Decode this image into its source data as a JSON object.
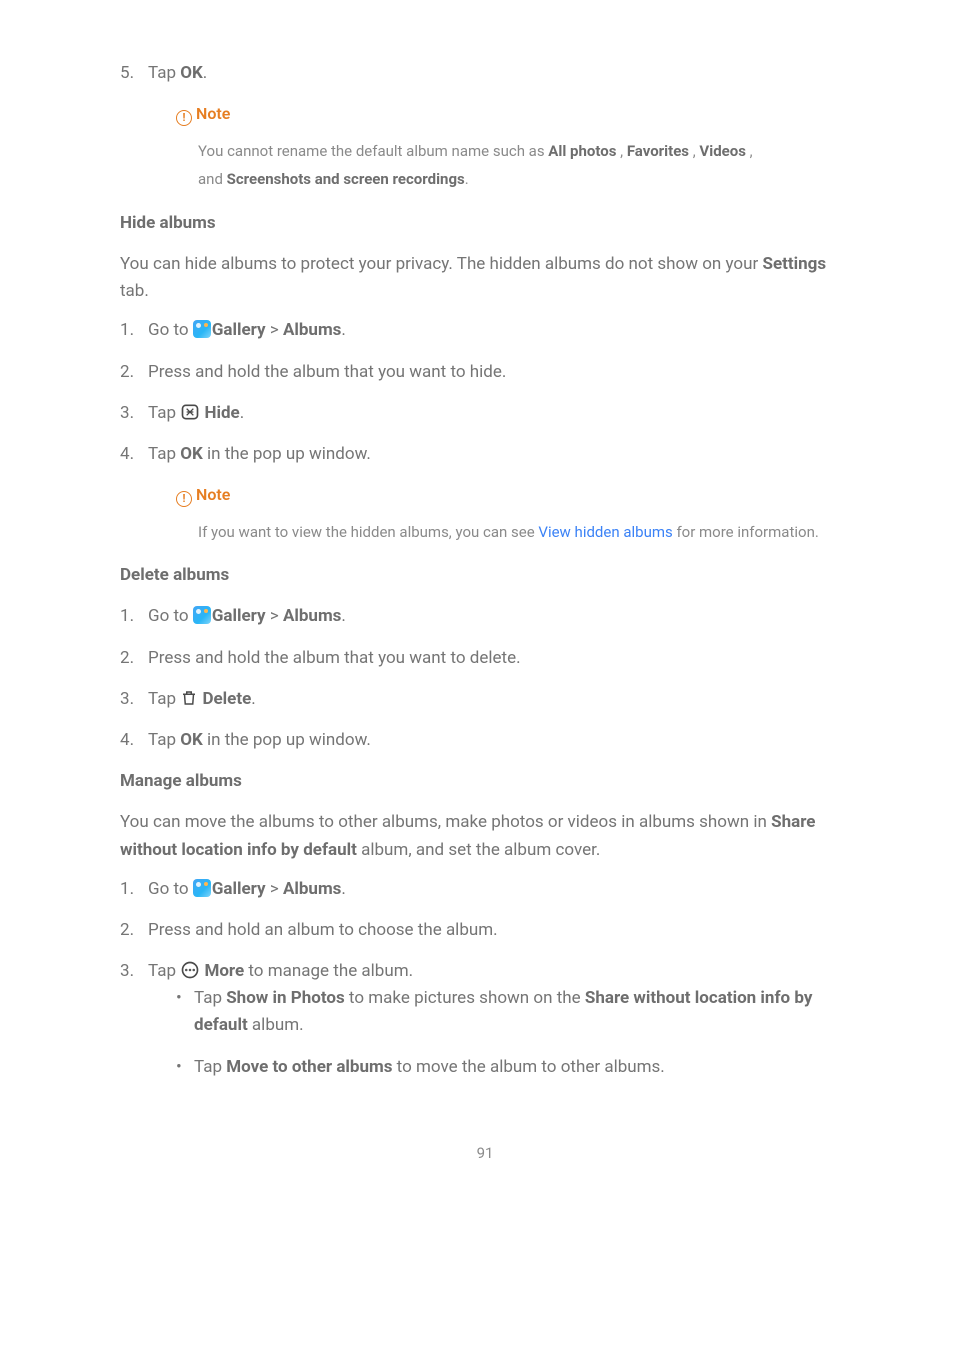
{
  "step5": {
    "prefix": "Tap ",
    "bold": "OK",
    "suffix": "."
  },
  "note1": {
    "label": "Note",
    "info_glyph": "!",
    "line1a": "You cannot rename the default album name such as ",
    "all_photos": "All photos",
    "sep1": " , ",
    "favorites": "Favorites",
    "sep2": " , ",
    "videos": "Videos",
    "sep3": " ,",
    "line2a": "and ",
    "screenshots": "Screenshots and screen recordings",
    "line2b": "."
  },
  "hide": {
    "heading": "Hide albums",
    "intro1": "You can hide albums to protect your privacy. The hidden albums do not show on your ",
    "intro_bold": "Settings",
    "intro2": " tab.",
    "s1_a": "Go to ",
    "s1_gallery": "Gallery",
    "s1_sep": " > ",
    "s1_albums": "Albums",
    "s1_end": ".",
    "s2": "Press and hold the album that you want to hide.",
    "s3_a": "Tap ",
    "s3_b": " Hide",
    "s3_c": ".",
    "s4_a": "Tap ",
    "s4_b": "OK",
    "s4_c": " in the pop up window."
  },
  "note2": {
    "label": "Note",
    "info_glyph": "!",
    "body_a": "If you want to view the hidden albums, you can see ",
    "link": "View hidden albums",
    "body_b": " for more information."
  },
  "delete": {
    "heading": "Delete albums",
    "s1_a": "Go to ",
    "s1_gallery": "Gallery",
    "s1_sep": " > ",
    "s1_albums": "Albums",
    "s1_end": ".",
    "s2": "Press and hold the album that you want to delete.",
    "s3_a": "Tap ",
    "s3_b": " Delete",
    "s3_c": ".",
    "s4_a": "Tap ",
    "s4_b": "OK",
    "s4_c": " in the pop up window."
  },
  "manage": {
    "heading": "Manage albums",
    "intro_a": "You can move the albums to other albums, make photos or videos in albums shown in ",
    "intro_bold": "Share without location info by default",
    "intro_b": " album, and set the album cover.",
    "s1_a": "Go to ",
    "s1_gallery": "Gallery",
    "s1_sep": " > ",
    "s1_albums": "Albums",
    "s1_end": ".",
    "s2": "Press and hold an album to choose the album.",
    "s3_a": "Tap ",
    "s3_b": " More",
    "s3_c": " to manage the album.",
    "b1_a": "Tap ",
    "b1_bold1": "Show in Photos",
    "b1_b": " to make pictures shown on the ",
    "b1_bold2": "Share without location info by default",
    "b1_c": " album.",
    "b2_a": "Tap ",
    "b2_bold": "Move to other albums",
    "b2_b": " to move the album to other albums."
  },
  "page_number": "91"
}
